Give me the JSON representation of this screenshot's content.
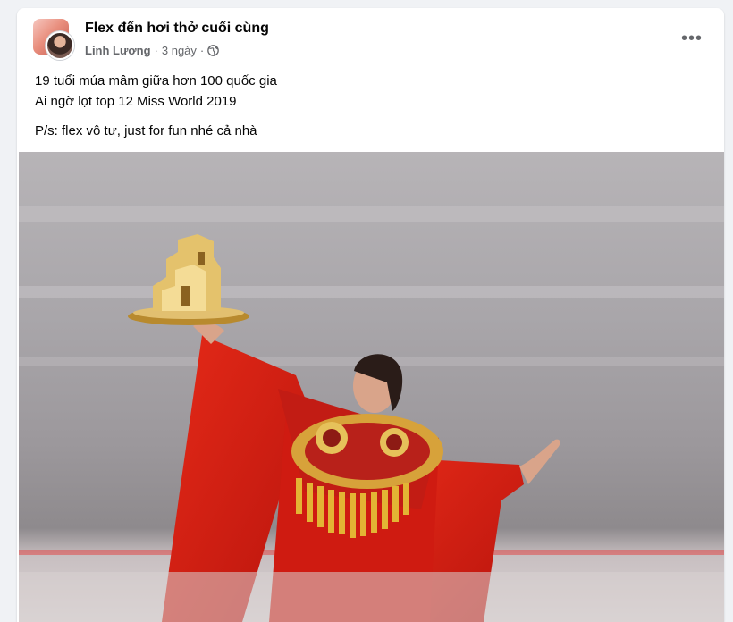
{
  "post": {
    "group_name": "Flex đến hơi thở cuối cùng",
    "author": "Linh Lương",
    "separator": "·",
    "time": "3 ngày",
    "privacy_icon": "globe-icon",
    "more_icon": "more-options-icon",
    "more_label": "•••",
    "lines": [
      "19 tuổi múa mâm giữa hơn 100 quốc gia",
      "Ai ngờ lọt top 12 Miss World 2019",
      "P/s: flex vô tư, just for fun nhé cả nhà"
    ]
  },
  "colors": {
    "background": "#f0f2f5",
    "card": "#ffffff",
    "secondary_text": "#65676b",
    "costume_red": "#d81d12",
    "gold": "#e0b23a"
  }
}
